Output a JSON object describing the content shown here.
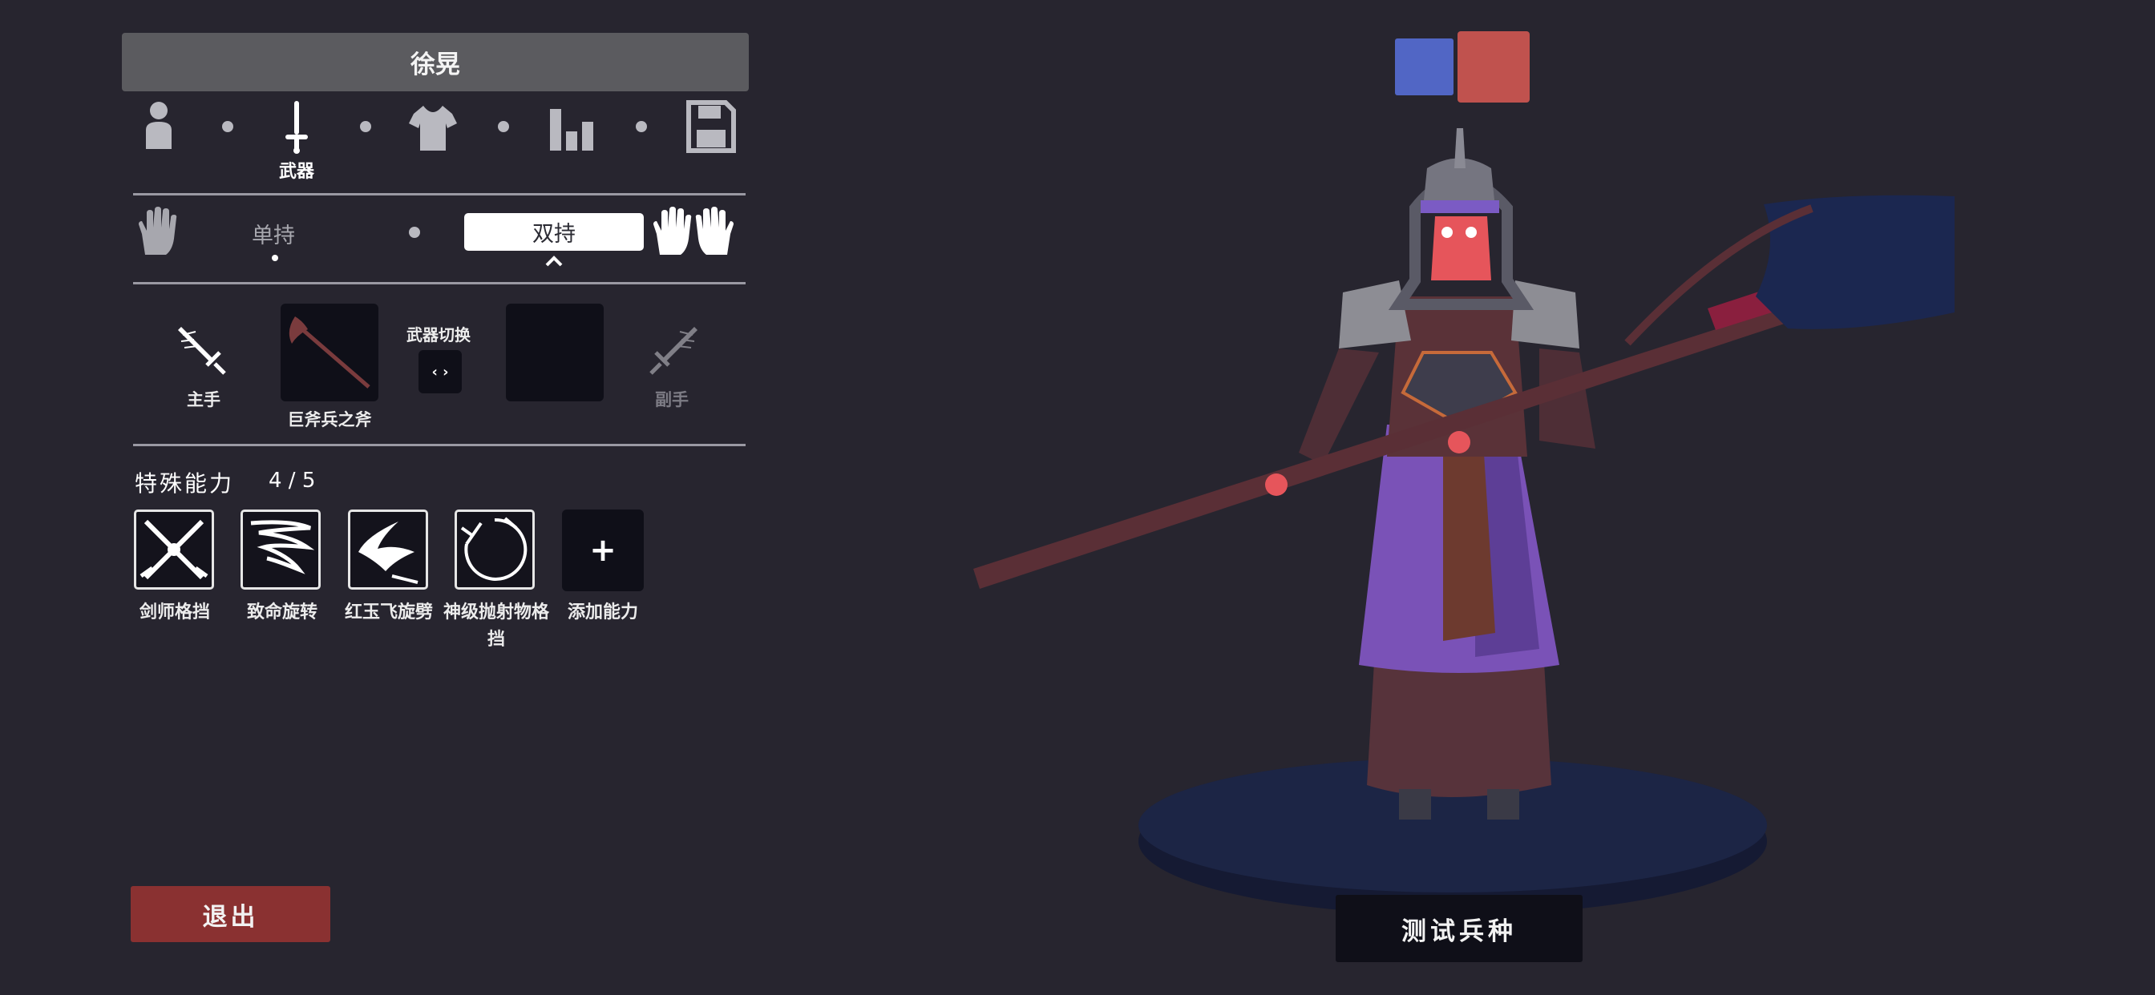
{
  "unit": {
    "name": "徐晃"
  },
  "editor_steps": [
    {
      "id": "body",
      "icon": "person-icon",
      "label": ""
    },
    {
      "id": "weapon",
      "icon": "sword-icon",
      "label": "武器",
      "active": true
    },
    {
      "id": "clothing",
      "icon": "shirt-icon",
      "label": ""
    },
    {
      "id": "stats",
      "icon": "bar-chart-icon",
      "label": ""
    },
    {
      "id": "save",
      "icon": "floppy-disk-icon",
      "label": ""
    }
  ],
  "grip": {
    "single_label": "单持",
    "dual_label": "双持",
    "selected": "双持"
  },
  "weapons": {
    "main_hand_label": "主手",
    "main_weapon_name": "巨斧兵之斧",
    "switch_label": "武器切换",
    "switch_button_text": "‹ ›",
    "off_hand_label": "副手"
  },
  "abilities": {
    "title": "特殊能力",
    "count": "4 / 5",
    "items": [
      {
        "label": "剑师格挡",
        "icon": "crossed-swords-icon"
      },
      {
        "label": "致命旋转",
        "icon": "spin-slash-icon"
      },
      {
        "label": "红玉飞旋劈",
        "icon": "flying-slash-icon"
      },
      {
        "label": "神级抛射物格挡",
        "icon": "projectile-block-icon"
      }
    ],
    "add_label": "添加能力",
    "add_symbol": "+"
  },
  "exit_label": "退出",
  "test_unit_label": "测试兵种",
  "team_colors": {
    "blue": "#5166c5",
    "red": "#c0524e"
  }
}
